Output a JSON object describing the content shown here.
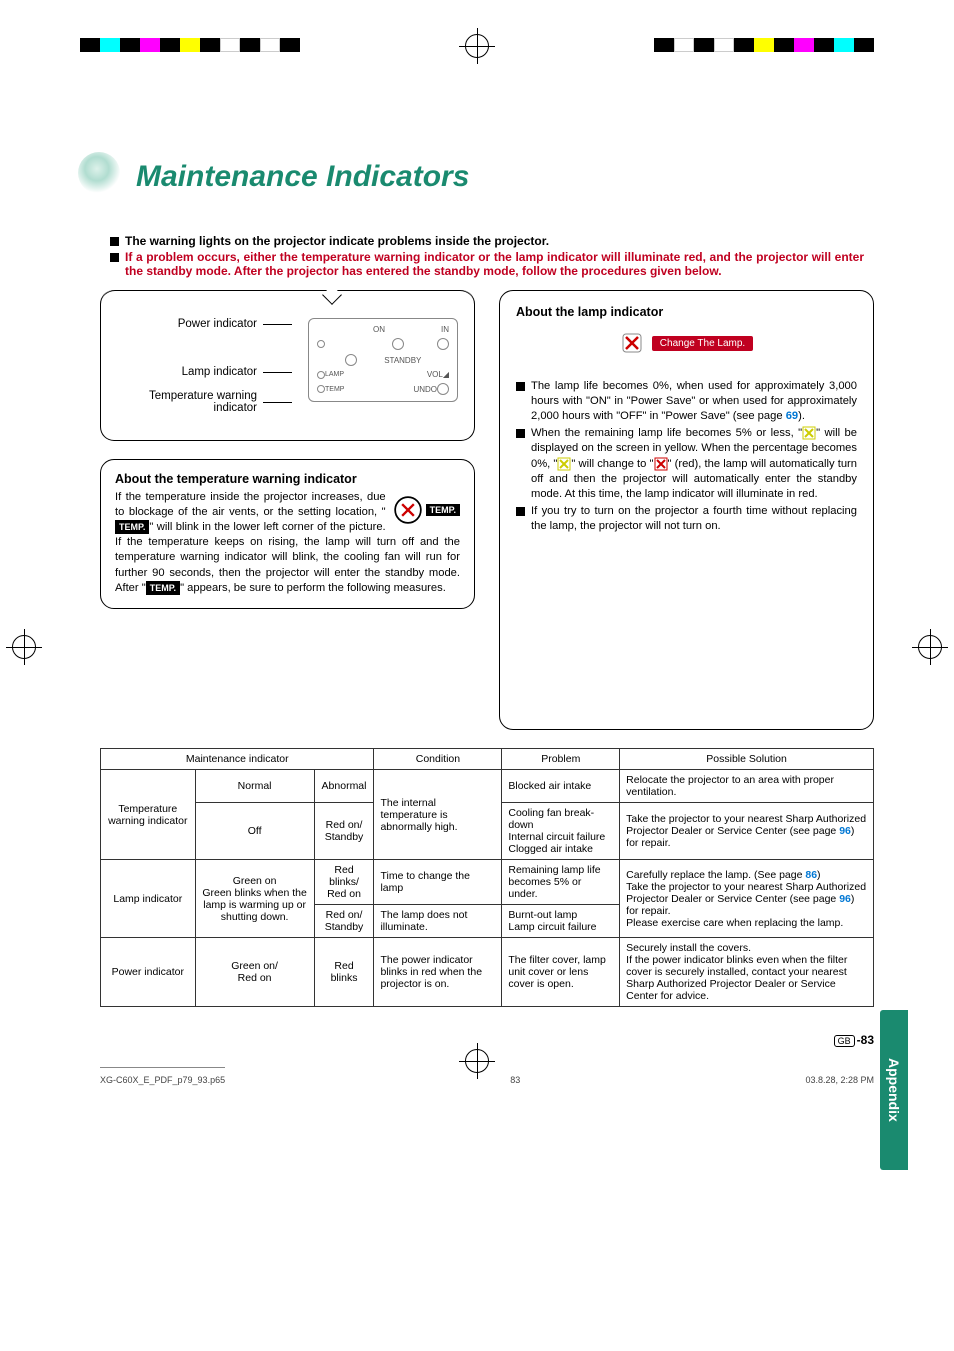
{
  "page_title": "Maintenance Indicators",
  "intro": {
    "item1": "The warning lights on the projector indicate problems inside the projector.",
    "item2": "If a problem occurs, either the temperature warning indicator or the lamp indicator will illuminate red, and the projector will enter the standby mode. After the projector has entered the standby mode, follow the procedures given below."
  },
  "diagram": {
    "power": "Power indicator",
    "lamp": "Lamp indicator",
    "temp": "Temperature warning indicator",
    "panel": {
      "on": "ON",
      "in": "IN",
      "standby": "STANDBY",
      "lamp": "LAMP",
      "vol": "VOL",
      "temp": "TEMP",
      "undo": "UNDO"
    }
  },
  "temp_box": {
    "head": "About the temperature warning indicator",
    "badge": "TEMP.",
    "p1a": "If the temperature inside the projector increases, due to blockage of the air vents, or the setting location, \"",
    "p1b": "\" will blink in the lower left corner of the picture. If the temperature keeps on rising, the lamp will turn off and the temperature warning indicator will blink, the cooling fan will run for further 90 seconds, then the projector will enter the standby mode. After \"",
    "p1c": "\" appears, be sure to perform the following measures."
  },
  "lamp_box": {
    "head": "About the lamp indicator",
    "banner": "Change The Lamp.",
    "i1a": "The lamp life becomes 0%, when used for approximately 3,000 hours with \"ON\" in \"Power Save\" or when used for approximately 2,000 hours with \"OFF\" in \"Power Save\" (see page ",
    "i1b": ").",
    "i1_link": "69",
    "i2": "When the remaining lamp life becomes 5% or less, \"  \" will be displayed on the screen in yellow. When the percentage becomes 0%, \"  \" will change to \"  \" (red), the lamp will automatically turn off and then the projector will automatically enter the standby mode. At this time, the lamp indicator will illuminate in red.",
    "i3": "If you try to turn on the projector a fourth time without replacing the lamp, the projector will not turn on."
  },
  "table": {
    "h_mi": "Maintenance indicator",
    "h_cond": "Condition",
    "h_prob": "Problem",
    "h_sol": "Possible Solution",
    "h_norm": "Normal",
    "h_ab": "Abnormal",
    "r_temp": "Temperature warning indicator",
    "r_lamp": "Lamp indicator",
    "r_power": "Power indicator",
    "t_off": "Off",
    "t_redstby": "Red on/\nStandby",
    "t_cond1": "The internal temperature is abnormally high.",
    "t_p1": "Blocked air intake",
    "t_s1": "Relocate the projector to an area with proper ventilation.",
    "t_p2": "Cooling fan break-down\nInternal circuit failure\nClogged air intake",
    "t_s2a": "Take the projector to your nearest Sharp Authorized Projector Dealer or Service Center (see page ",
    "t_s2b": ") for repair.",
    "t_s2_link": "96",
    "l_norm": "Green on\nGreen blinks when the lamp is warming up or shutting down.",
    "l_ab1": "Red blinks/\nRed on",
    "l_ab2": "Red on/\nStandby",
    "l_c1": "Time to change the lamp",
    "l_c2": "The lamp does not illuminate.",
    "l_p1": "Remaining lamp life becomes 5% or under.",
    "l_p2": "Burnt-out lamp\nLamp circuit failure",
    "l_s1a": "Carefully replace the lamp. (See page ",
    "l_s1b": ")\nTake the projector to your nearest Sharp Authorized Projector Dealer or Service Center (see page ",
    "l_s1c": ") for repair.\nPlease exercise care when replacing the lamp.",
    "l_s1_link1": "86",
    "l_s1_link2": "96",
    "p_norm": "Green on/\nRed on",
    "p_ab": "Red blinks",
    "p_c": "The power indicator blinks in red when the projector is on.",
    "p_p": "The filter cover, lamp unit cover or lens cover is open.",
    "p_s": "Securely install the covers.\nIf the power indicator blinks even when the filter cover is securely installed, contact your nearest Sharp Authorized Projector Dealer or Service Center for advice."
  },
  "side_tab": "Appendix",
  "pagenum": "-83",
  "gb": "GB",
  "footer": {
    "file": "XG-C60X_E_PDF_p79_93.p65",
    "page": "83",
    "date": "03.8.28, 2:28 PM"
  }
}
